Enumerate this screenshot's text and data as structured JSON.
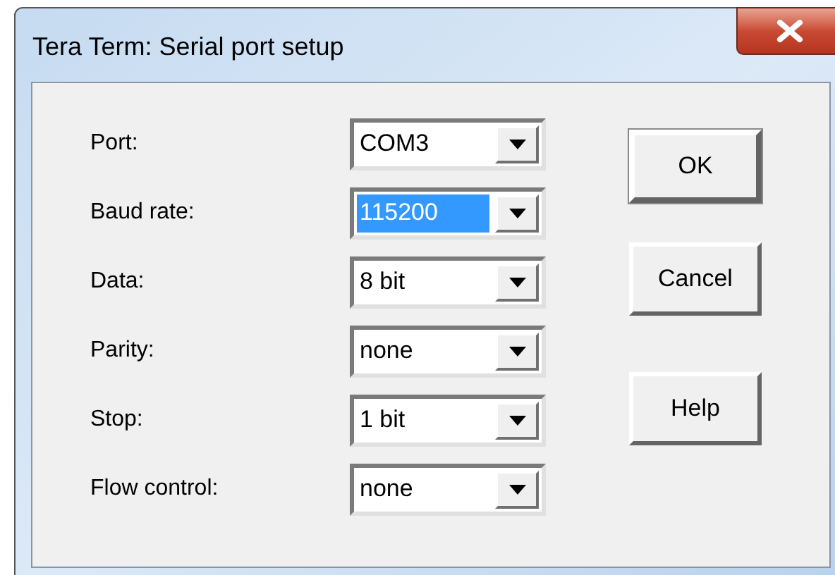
{
  "window": {
    "title": "Tera Term: Serial port setup"
  },
  "fields": [
    {
      "label": "Port:",
      "value": "COM3",
      "selected": false
    },
    {
      "label": "Baud rate:",
      "value": "115200",
      "selected": true
    },
    {
      "label": "Data:",
      "value": "8 bit",
      "selected": false
    },
    {
      "label": "Parity:",
      "value": "none",
      "selected": false
    },
    {
      "label": "Stop:",
      "value": "1 bit",
      "selected": false
    },
    {
      "label": "Flow control:",
      "value": "none",
      "selected": false
    }
  ],
  "buttons": [
    {
      "label": "OK",
      "kind": "default"
    },
    {
      "label": "Cancel",
      "kind": "normal"
    },
    {
      "label": "Help",
      "kind": "normal"
    }
  ]
}
